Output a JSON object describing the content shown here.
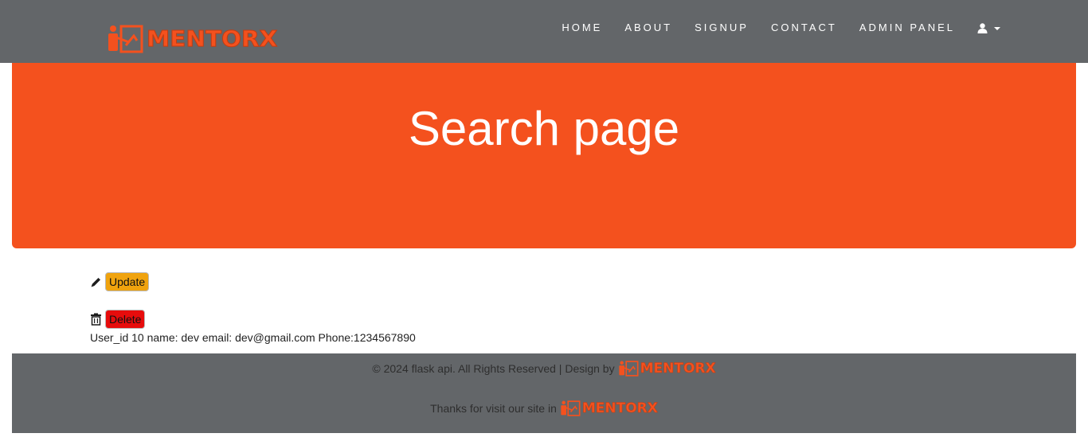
{
  "brand": {
    "name": "MENTORX",
    "color": "#f4511e",
    "icon": "teacher-board-icon"
  },
  "nav": {
    "items": [
      "HOME",
      "ABOUT",
      "SIGNUP",
      "CONTACT",
      "ADMIN PANEL"
    ],
    "user_icon": "user-icon"
  },
  "hero": {
    "title": "Search page",
    "background": "#f4511e"
  },
  "actions": {
    "update_icon": "pencil-icon",
    "update_label": "Update",
    "update_color": "#f0a30e",
    "delete_icon": "trash-icon",
    "delete_label": "Delete",
    "delete_color": "#e70c0c"
  },
  "user_record": "User_id 10 name: dev email: dev@gmail.com Phone:1234567890",
  "footer": {
    "line1": "© 2024 flask api. All Rights Reserved | Design by",
    "line2": "Thanks for visit our site in",
    "logo_text": "MENTORX",
    "background": "#636669"
  }
}
